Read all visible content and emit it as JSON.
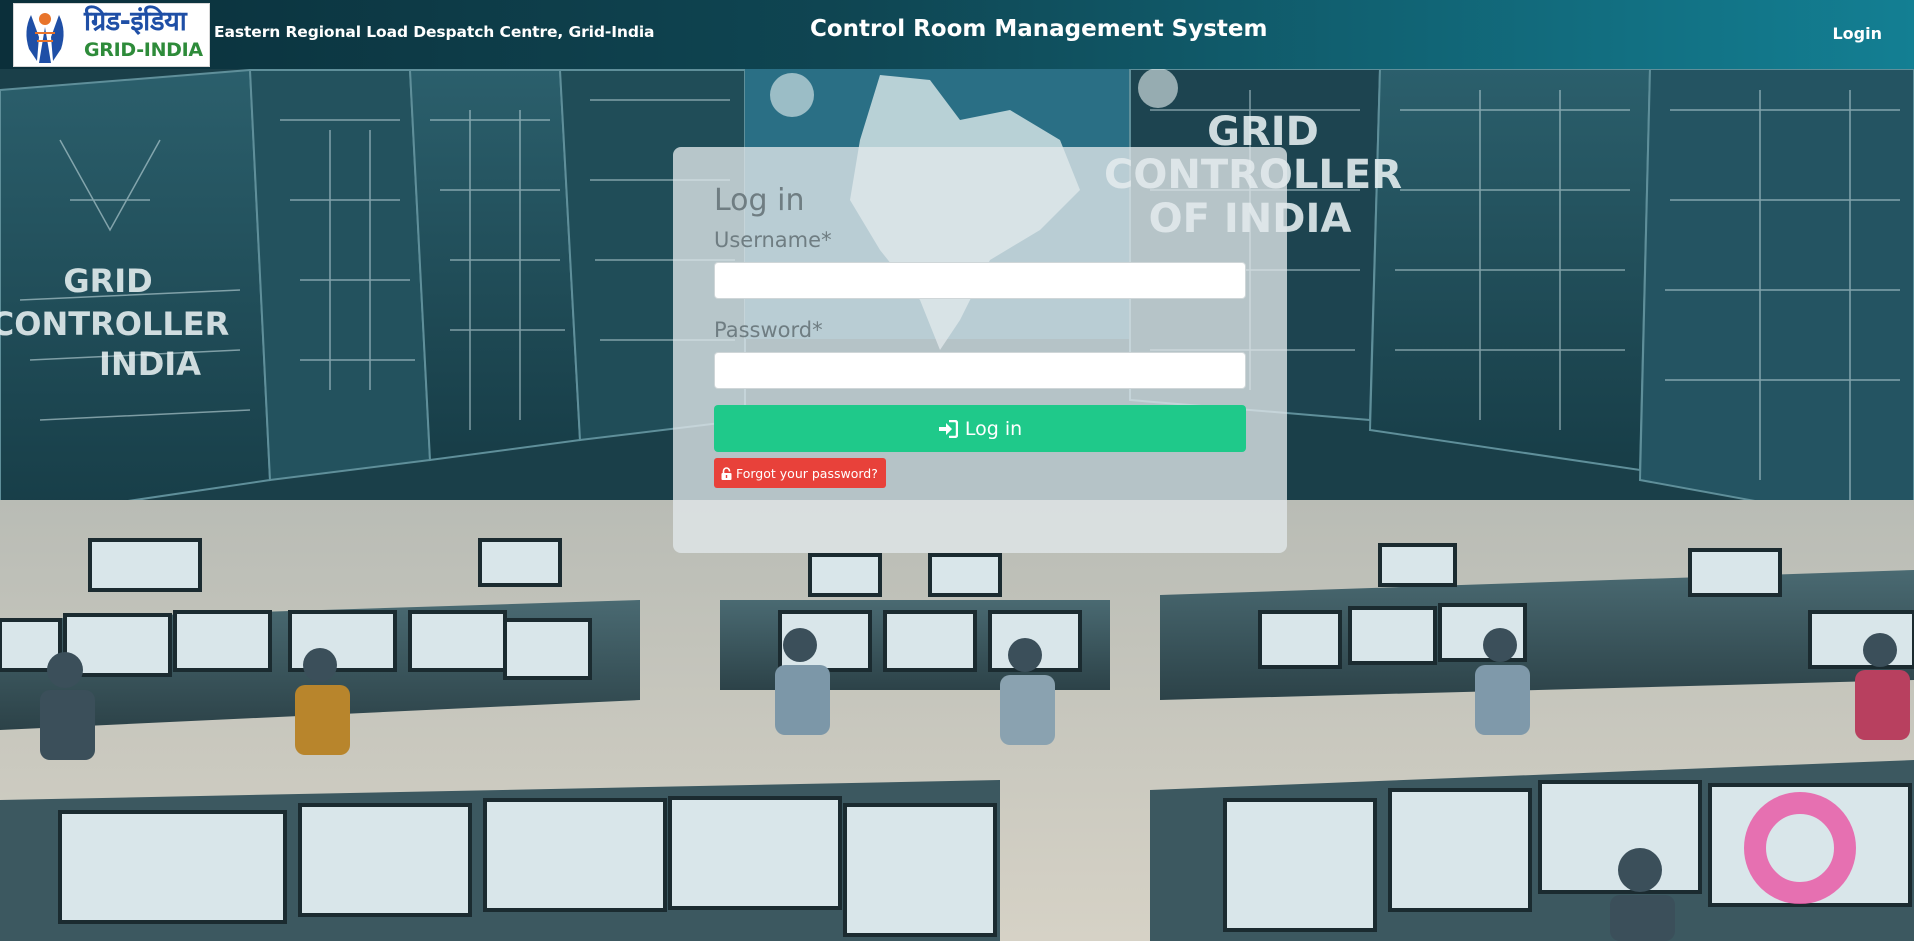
{
  "header": {
    "logo_hindi": "ग्रिड-इंडिया",
    "logo_english": "GRID-INDIA",
    "org_name": "Eastern Regional Load Despatch Centre, Grid-India",
    "app_title": "Control Room Management System",
    "nav_login": "Login"
  },
  "background": {
    "wall_text_center": [
      "GRID",
      "CONTROLLER",
      "OF INDIA"
    ],
    "wall_text_left": [
      "GRID",
      "CONTROLLER",
      "INDIA"
    ]
  },
  "login_form": {
    "title": "Log in",
    "username_label": "Username",
    "password_label": "Password",
    "required_marker": "*",
    "username_value": "",
    "password_value": "",
    "submit_label": "Log in",
    "forgot_label": "Forgot your password?"
  },
  "icons": {
    "submit_icon": "sign-in-icon",
    "forgot_icon": "unlock-icon"
  },
  "colors": {
    "header_dark": "#0b2f3a",
    "header_light": "#137f93",
    "submit_button": "#1fc98a",
    "forgot_button": "#e8413a",
    "card_text": "#6f7d82"
  }
}
